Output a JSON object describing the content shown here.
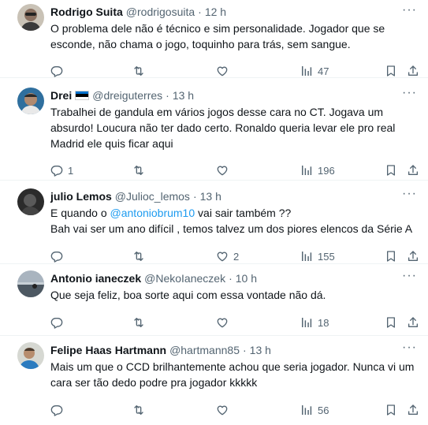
{
  "tweets": [
    {
      "name": "Rodrigo Suita",
      "handle": "@rodrigosuita",
      "time": "12 h",
      "text": "O problema dele não é técnico e sim personalidade. Jogador que se esconde, não chama o jogo, toquinho para trás, sem sangue.",
      "replies": "",
      "retweets": "",
      "likes": "",
      "views": "47"
    },
    {
      "name": "Drei",
      "flag": "estonia-flag",
      "handle": "@dreiguterres",
      "time": "13 h",
      "text": "Trabalhei de gandula em vários jogos desse cara no CT. Jogava um absurdo! Loucura não ter dado certo. Ronaldo queria levar ele pro real Madrid ele quis ficar aqui",
      "replies": "1",
      "retweets": "",
      "likes": "",
      "views": "196"
    },
    {
      "name": "julio Lemos",
      "handle": "@Julioc_lemos",
      "time": "13 h",
      "text_before": "E quando o ",
      "mention": "@antoniobrum10",
      "text_after": " vai sair também ??",
      "text_line2": "Bah vai ser um ano difícil , temos talvez um dos piores elencos da Série A",
      "replies": "",
      "retweets": "",
      "likes": "2",
      "views": "155"
    },
    {
      "name": "Antonio ianeczek",
      "handle": "@NekoIaneczek",
      "time": "10 h",
      "text": "Que seja feliz, boa sorte aqui com essa vontade não dá.",
      "replies": "",
      "retweets": "",
      "likes": "",
      "views": "18"
    },
    {
      "name": "Felipe Haas Hartmann",
      "handle": "@hartmann85",
      "time": "13 h",
      "text": "Mais um que o CCD brilhantemente achou que seria jogador. Nunca vi um cara ser tão dedo podre pra jogador kkkkk",
      "replies": "",
      "retweets": "",
      "likes": "",
      "views": "56"
    }
  ],
  "separator": "·",
  "more_label": "···",
  "colors": {
    "text": "#0f1419",
    "secondary": "#536471",
    "link": "#1d9bf0",
    "divider": "#eff3f4"
  },
  "icons": [
    "reply-icon",
    "retweet-icon",
    "like-icon",
    "views-icon",
    "bookmark-icon",
    "share-icon",
    "more-icon"
  ]
}
